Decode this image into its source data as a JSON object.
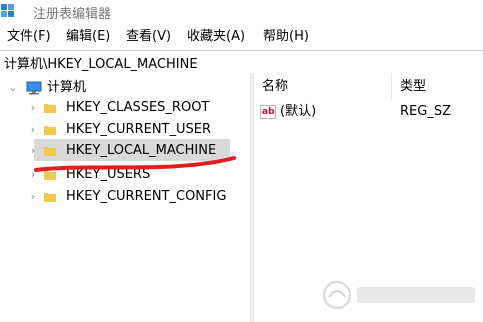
{
  "window": {
    "title": "注册表编辑器"
  },
  "menu": [
    "文件(F)",
    "编辑(E)",
    "查看(V)",
    "收藏夹(A)",
    "帮助(H)"
  ],
  "address": "计算机\\HKEY_LOCAL_MACHINE",
  "tree": {
    "root": "计算机",
    "items": [
      "HKEY_CLASSES_ROOT",
      "HKEY_CURRENT_USER",
      "HKEY_LOCAL_MACHINE",
      "HKEY_USERS",
      "HKEY_CURRENT_CONFIG"
    ],
    "selected": "HKEY_LOCAL_MACHINE"
  },
  "list": {
    "columns": [
      "名称",
      "类型"
    ],
    "rows": [
      {
        "name": "(默认)",
        "type": "REG_SZ"
      }
    ]
  },
  "icons": {
    "app": "registry-editor-icon",
    "computer": "computer-icon",
    "folder": "folder-icon",
    "value": "string-value-icon",
    "chevron": "chevron-right-icon",
    "chevron_expanded": "chevron-down-icon"
  },
  "colors": {
    "folder": "#f2c94c",
    "selection": "#d9d9d9",
    "annotation": "#e01e1e",
    "value_icon": "#c8102e"
  }
}
